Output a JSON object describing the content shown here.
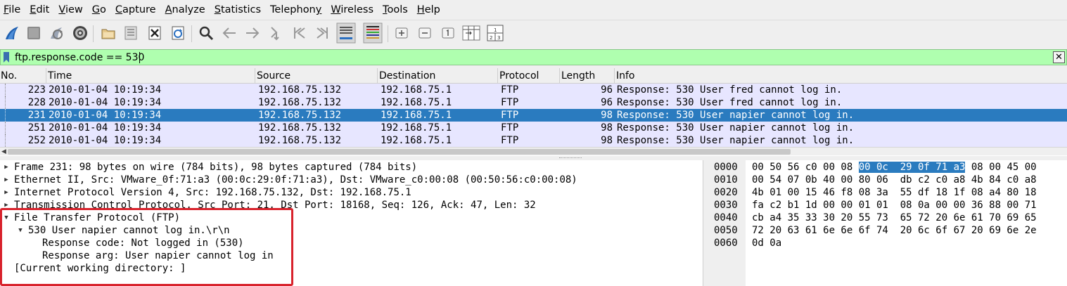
{
  "menu": [
    "File",
    "Edit",
    "View",
    "Go",
    "Capture",
    "Analyze",
    "Statistics",
    "Telephony",
    "Wireless",
    "Tools",
    "Help"
  ],
  "menu_mnemonics": [
    "F",
    "E",
    "V",
    "G",
    "C",
    "A",
    "S",
    "y",
    "W",
    "T",
    "H"
  ],
  "toolbar": {
    "icons": [
      "shark-fin-start-icon",
      "stop-capture-icon",
      "restart-capture-icon",
      "capture-options-gear-icon",
      "open-file-icon",
      "save-file-icon",
      "close-file-icon",
      "reload-file-icon",
      "find-packet-icon",
      "go-back-icon",
      "go-forward-icon",
      "go-to-packet-icon",
      "go-first-packet-icon",
      "go-last-packet-icon",
      "autoscroll-icon",
      "colorize-icon",
      "zoom-in-icon",
      "zoom-out-icon",
      "normal-size-icon",
      "resize-columns-icon",
      "layout-icon"
    ]
  },
  "filter": {
    "value": "ftp.response.code == 530",
    "clear_label": "✕",
    "bg_color": "#afffaf"
  },
  "packet_list": {
    "columns": [
      "No.",
      "Time",
      "Source",
      "Destination",
      "Protocol",
      "Length",
      "Info"
    ],
    "rows": [
      {
        "no": "223",
        "time": "2010-01-04 10:19:34",
        "src": "192.168.75.132",
        "dst": "192.168.75.1",
        "proto": "FTP",
        "len": "96",
        "info": "Response: 530 User fred cannot log in."
      },
      {
        "no": "228",
        "time": "2010-01-04 10:19:34",
        "src": "192.168.75.132",
        "dst": "192.168.75.1",
        "proto": "FTP",
        "len": "96",
        "info": "Response: 530 User fred cannot log in."
      },
      {
        "no": "231",
        "time": "2010-01-04 10:19:34",
        "src": "192.168.75.132",
        "dst": "192.168.75.1",
        "proto": "FTP",
        "len": "98",
        "info": "Response: 530 User napier cannot log in."
      },
      {
        "no": "251",
        "time": "2010-01-04 10:19:34",
        "src": "192.168.75.132",
        "dst": "192.168.75.1",
        "proto": "FTP",
        "len": "98",
        "info": "Response: 530 User napier cannot log in."
      },
      {
        "no": "252",
        "time": "2010-01-04 10:19:34",
        "src": "192.168.75.132",
        "dst": "192.168.75.1",
        "proto": "FTP",
        "len": "98",
        "info": "Response: 530 User napier cannot log in."
      }
    ],
    "selected_no": "231",
    "row_color": "#e7e6ff",
    "selected_color": "#2a7bbf"
  },
  "details": {
    "rows": [
      {
        "text": "Frame 231: 98 bytes on wire (784 bits), 98 bytes captured (784 bits)",
        "expander": "collapsed",
        "level": 0
      },
      {
        "text": "Ethernet II, Src: VMware_0f:71:a3 (00:0c:29:0f:71:a3), Dst: VMware_c0:00:08 (00:50:56:c0:00:08)",
        "expander": "collapsed",
        "level": 0
      },
      {
        "text": "Internet Protocol Version 4, Src: 192.168.75.132, Dst: 192.168.75.1",
        "expander": "collapsed",
        "level": 0
      },
      {
        "text": "Transmission Control Protocol, Src Port: 21, Dst Port: 18168, Seq: 126, Ack: 47, Len: 32",
        "expander": "collapsed",
        "level": 0
      },
      {
        "text": "File Transfer Protocol (FTP)",
        "expander": "expanded",
        "level": 0
      },
      {
        "text": "530 User napier cannot log in.\\r\\n",
        "expander": "expanded",
        "level": 1
      },
      {
        "text": "Response code: Not logged in (530)",
        "expander": "none",
        "level": 2
      },
      {
        "text": "Response arg: User napier cannot log in",
        "expander": "none",
        "level": 2
      },
      {
        "text": "[Current working directory: ]",
        "expander": "none",
        "level": 0
      }
    ],
    "highlight_color": "#d8222c"
  },
  "hex": {
    "rows": [
      {
        "offset": "0000",
        "pre": "00 50 56 c0 00 08 ",
        "sel": "00 0c  29 0f 71 a3",
        "post": " 08 00 45 00"
      },
      {
        "offset": "0010",
        "pre": "00 54 07 0b 40 00 80 06  db c2 c0 a8 4b 84 c0 a8",
        "sel": "",
        "post": ""
      },
      {
        "offset": "0020",
        "pre": "4b 01 00 15 46 f8 08 3a  55 df 18 1f 08 a4 80 18",
        "sel": "",
        "post": ""
      },
      {
        "offset": "0030",
        "pre": "fa c2 b1 1d 00 00 01 01  08 0a 00 00 36 88 00 71",
        "sel": "",
        "post": ""
      },
      {
        "offset": "0040",
        "pre": "cb a4 35 33 30 20 55 73  65 72 20 6e 61 70 69 65",
        "sel": "",
        "post": ""
      },
      {
        "offset": "0050",
        "pre": "72 20 63 61 6e 6e 6f 74  20 6c 6f 67 20 69 6e 2e",
        "sel": "",
        "post": ""
      },
      {
        "offset": "0060",
        "pre": "0d 0a",
        "sel": "",
        "post": ""
      }
    ]
  }
}
